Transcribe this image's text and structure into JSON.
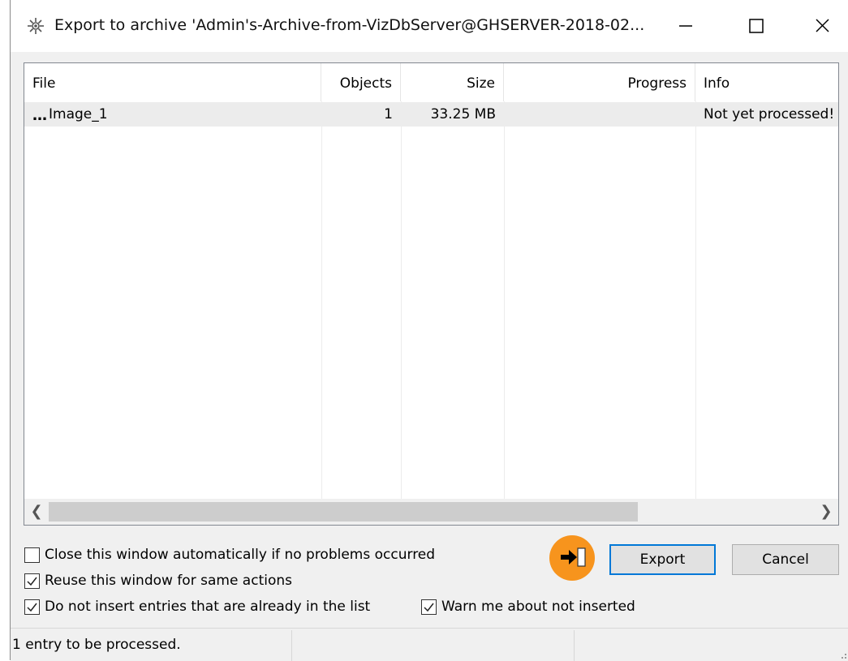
{
  "window": {
    "title": "Export to archive 'Admin's-Archive-from-VizDbServer@GHSERVER-2018-02..."
  },
  "list": {
    "columns": [
      "File",
      "Objects",
      "Size",
      "Progress",
      "Info"
    ],
    "rows": [
      {
        "file": "Image_1",
        "objects": "1",
        "size": "33.25 MB",
        "progress": "",
        "info": "Not yet processed!"
      }
    ]
  },
  "options": {
    "close_auto": {
      "label": "Close this window automatically if no problems occurred",
      "checked": false
    },
    "reuse": {
      "label": "Reuse this window for same actions",
      "checked": true
    },
    "no_insert": {
      "label": "Do not insert entries that are already in the list",
      "checked": true
    },
    "warn": {
      "label": "Warn me about not inserted",
      "checked": true
    }
  },
  "buttons": {
    "export": "Export",
    "cancel": "Cancel"
  },
  "status": {
    "text": "1 entry to be processed."
  },
  "icons": {
    "app": "gear-icon",
    "row": "ellipsis-icon",
    "export_action": "export-arrow-icon"
  },
  "colors": {
    "accent": "#0078d7",
    "highlight": "#f7941d"
  }
}
